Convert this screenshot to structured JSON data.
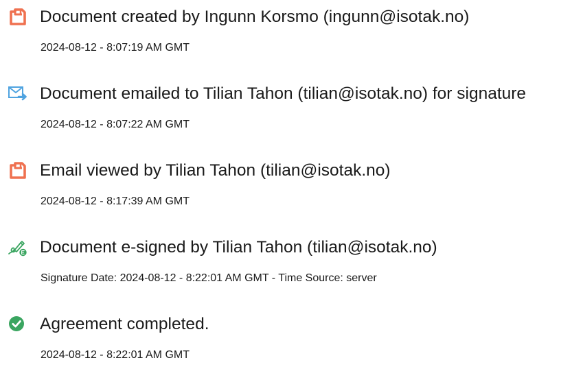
{
  "events": [
    {
      "icon": "document-created-icon",
      "title": "Document created by Ingunn Korsmo (ingunn@isotak.no)",
      "detail": "2024-08-12 - 8:07:19 AM GMT"
    },
    {
      "icon": "document-emailed-icon",
      "title": "Document emailed to Tilian Tahon (tilian@isotak.no) for signature",
      "detail": "2024-08-12 - 8:07:22 AM GMT"
    },
    {
      "icon": "email-viewed-icon",
      "title": "Email viewed by Tilian Tahon (tilian@isotak.no)",
      "detail": "2024-08-12 - 8:17:39 AM GMT"
    },
    {
      "icon": "e-signed-icon",
      "title": "Document e-signed by Tilian Tahon (tilian@isotak.no)",
      "detail": "Signature Date: 2024-08-12 - 8:22:01 AM GMT - Time Source: server"
    },
    {
      "icon": "agreement-completed-icon",
      "title": "Agreement completed.",
      "detail": "2024-08-12 - 8:22:01 AM GMT"
    }
  ],
  "colors": {
    "orange_accent": "#ef7150",
    "blue_accent": "#4fa3e0",
    "green_accent": "#3aa560",
    "text": "#1a1a1a"
  }
}
